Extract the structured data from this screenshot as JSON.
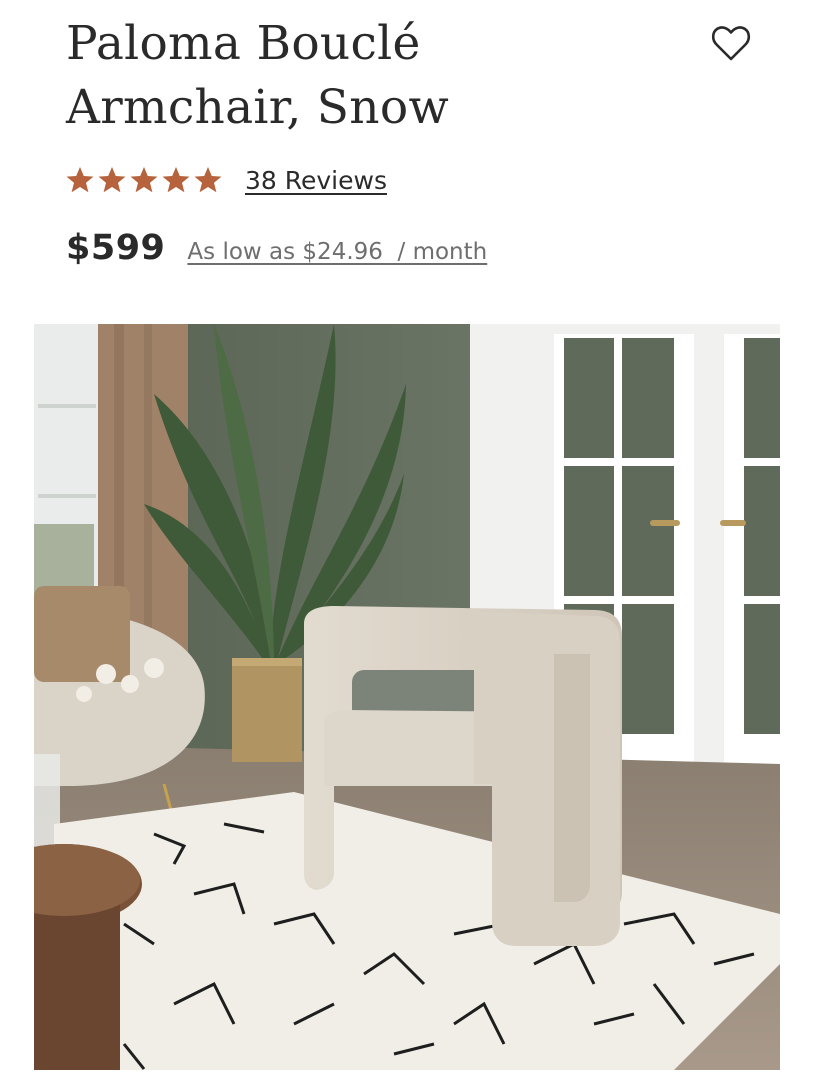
{
  "product": {
    "title": "Paloma Bouclé Armchair, Snow",
    "rating": 5,
    "reviews_label": "38 Reviews",
    "price": "$599",
    "financing_label": "As low as $24.96  / month"
  },
  "icons": {
    "wishlist": "heart-outline-icon",
    "star": "star-icon"
  },
  "colors": {
    "star": "#b5623d",
    "text": "#2a2a2a",
    "muted": "#6e6e6e"
  }
}
